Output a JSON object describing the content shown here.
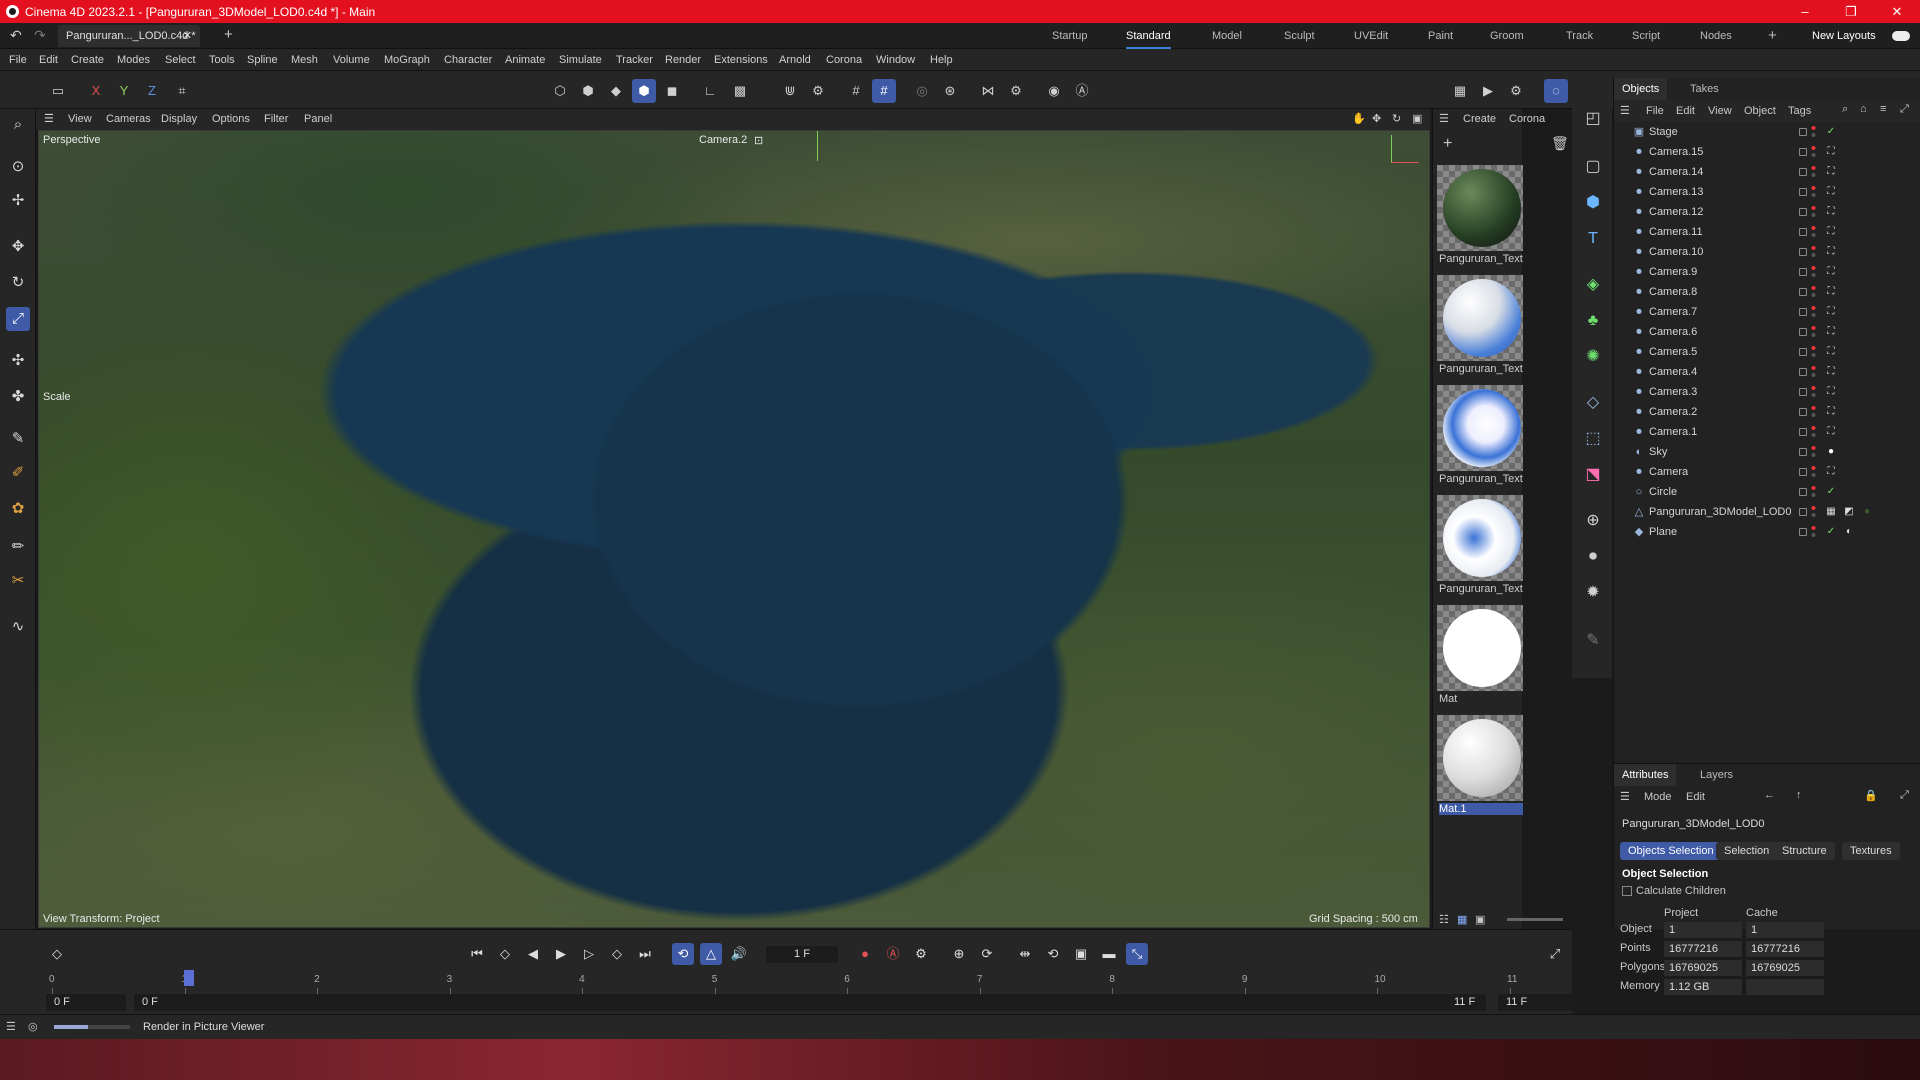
{
  "title": "Cinema 4D 2023.2.1 - [Pangururan_3DModel_LOD0.c4d *] - Main",
  "doc_tab": "Pangururan..._LOD0.c4d *",
  "layouts": [
    "Startup",
    "Standard",
    "Model",
    "Sculpt",
    "UVEdit",
    "Paint",
    "Groom",
    "Track",
    "Script",
    "Nodes"
  ],
  "new_layouts": "New Layouts",
  "menu": [
    "File",
    "Edit",
    "Create",
    "Modes",
    "Select",
    "Tools",
    "Spline",
    "Mesh",
    "Volume",
    "MoGraph",
    "Character",
    "Animate",
    "Simulate",
    "Tracker",
    "Render",
    "Extensions",
    "Arnold",
    "Corona",
    "Window",
    "Help"
  ],
  "axis": {
    "x": "X",
    "y": "Y",
    "z": "Z"
  },
  "viewport": {
    "menu": [
      "View",
      "Cameras",
      "Display",
      "Options",
      "Filter",
      "Panel"
    ],
    "mode": "Perspective",
    "camera": "Camera.2",
    "scale_label": "Scale",
    "view_transform": "View Transform: Project",
    "grid_spacing": "Grid Spacing : 500 cm"
  },
  "materials": {
    "menu": [
      "Create",
      "Corona"
    ],
    "items": [
      {
        "label": "Pangururan_Textu",
        "kind": "terrain"
      },
      {
        "label": "Pangururan_Textu",
        "kind": "blue"
      },
      {
        "label": "Pangururan_Textu",
        "kind": "blue"
      },
      {
        "label": "Pangururan_Textu",
        "kind": "blue"
      },
      {
        "label": "Mat",
        "kind": "white"
      },
      {
        "label": "Mat.1",
        "kind": "grey"
      }
    ]
  },
  "objects_panel": {
    "tabs": [
      "Objects",
      "Takes"
    ],
    "menu": [
      "File",
      "Edit",
      "View",
      "Object",
      "Tags"
    ],
    "rows": [
      {
        "name": "Stage",
        "icon": "stage"
      },
      {
        "name": "Camera.15",
        "icon": "camera"
      },
      {
        "name": "Camera.14",
        "icon": "camera"
      },
      {
        "name": "Camera.13",
        "icon": "camera"
      },
      {
        "name": "Camera.12",
        "icon": "camera"
      },
      {
        "name": "Camera.11",
        "icon": "camera"
      },
      {
        "name": "Camera.10",
        "icon": "camera"
      },
      {
        "name": "Camera.9",
        "icon": "camera"
      },
      {
        "name": "Camera.8",
        "icon": "camera"
      },
      {
        "name": "Camera.7",
        "icon": "camera"
      },
      {
        "name": "Camera.6",
        "icon": "camera"
      },
      {
        "name": "Camera.5",
        "icon": "camera"
      },
      {
        "name": "Camera.4",
        "icon": "camera"
      },
      {
        "name": "Camera.3",
        "icon": "camera"
      },
      {
        "name": "Camera.2",
        "icon": "camera"
      },
      {
        "name": "Camera.1",
        "icon": "camera"
      },
      {
        "name": "Sky",
        "icon": "sky"
      },
      {
        "name": "Camera",
        "icon": "camera"
      },
      {
        "name": "Circle",
        "icon": "circle"
      },
      {
        "name": "Pangururan_3DModel_LOD0",
        "icon": "polygon"
      },
      {
        "name": "Plane",
        "icon": "plane"
      }
    ]
  },
  "attributes": {
    "tabs": [
      "Attributes",
      "Layers"
    ],
    "menu": [
      "Mode",
      "Edit"
    ],
    "object_name": "Pangururan_3DModel_LOD0",
    "buttons": [
      "Objects Selection",
      "Selection",
      "Structure",
      "Textures"
    ],
    "section": "Object Selection",
    "calc_children": "Calculate Children",
    "col_project": "Project",
    "col_cache": "Cache",
    "rows": [
      {
        "label": "Object",
        "project": "1",
        "cache": "1"
      },
      {
        "label": "Points",
        "project": "16777216",
        "cache": "16777216"
      },
      {
        "label": "Polygons",
        "project": "16769025",
        "cache": "16769025"
      },
      {
        "label": "Memory",
        "project": "1.12 GB",
        "cache": ""
      }
    ]
  },
  "timeline": {
    "frame": "1 F",
    "ticks": [
      "0",
      "1",
      "2",
      "3",
      "4",
      "5",
      "6",
      "7",
      "8",
      "9",
      "10",
      "11"
    ],
    "start": "0 F",
    "preview_start": "0 F",
    "preview_end": "11 F",
    "end": "11 F"
  },
  "status": {
    "text": "Render in Picture Viewer",
    "progress": 0.45
  },
  "colors": {
    "accent": "#3f5aa6",
    "titlebar": "#e3101f"
  }
}
